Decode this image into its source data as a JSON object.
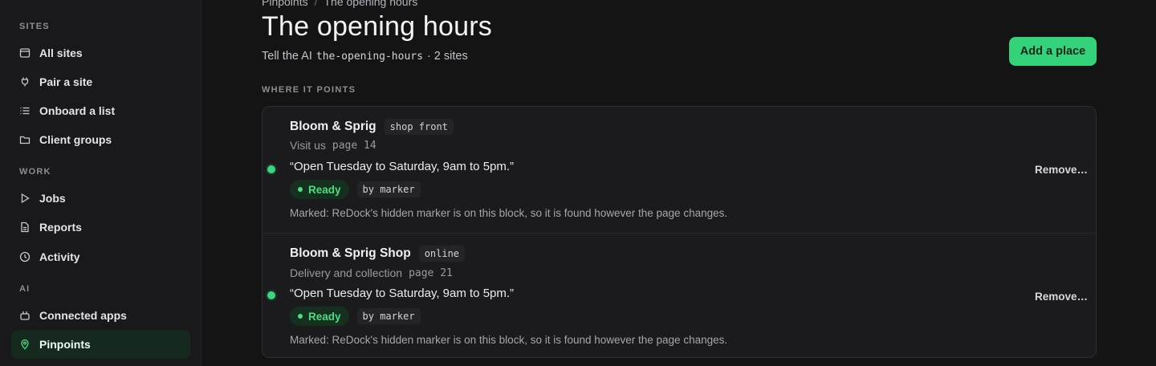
{
  "sidebar": {
    "sections": [
      {
        "label": "SITES"
      },
      {
        "label": "WORK"
      },
      {
        "label": "AI"
      }
    ],
    "items": [
      {
        "label": "All sites",
        "icon": "browser-window-icon"
      },
      {
        "label": "Pair a site",
        "icon": "plug-icon"
      },
      {
        "label": "Onboard a list",
        "icon": "list-icon"
      },
      {
        "label": "Client groups",
        "icon": "folder-icon"
      },
      {
        "label": "Jobs",
        "icon": "play-icon"
      },
      {
        "label": "Reports",
        "icon": "document-icon"
      },
      {
        "label": "Activity",
        "icon": "clock-icon"
      },
      {
        "label": "Connected apps",
        "icon": "plug-socket-icon"
      },
      {
        "label": "Pinpoints",
        "icon": "map-pin-icon",
        "active": true
      }
    ]
  },
  "header": {
    "breadcrumb": [
      "Pinpoints",
      "/",
      "The opening hours"
    ],
    "title": "The opening hours",
    "subtitle_prefix": "Tell the AI",
    "subtitle_code": "the-opening-hours",
    "subtitle_suffix": "· 2 sites",
    "add_button": "Add a place"
  },
  "main": {
    "section_label": "WHERE IT POINTS",
    "rows": [
      {
        "name": "Bloom & Sprig",
        "tag": "shop front",
        "page_label": "Visit us",
        "page_ref": "page 14",
        "quote": "“Open Tuesday to Saturday, 9am to 5pm.”",
        "status": "Ready",
        "method": "by marker",
        "note": "Marked: ReDock's hidden marker is on this block, so it is found however the page changes.",
        "remove": "Remove…"
      },
      {
        "name": "Bloom & Sprig Shop",
        "tag": "online",
        "page_label": "Delivery and collection",
        "page_ref": "page 21",
        "quote": "“Open Tuesday to Saturday, 9am to 5pm.”",
        "status": "Ready",
        "method": "by marker",
        "note": "Marked: ReDock's hidden marker is on this block, so it is found however the page changes.",
        "remove": "Remove…"
      }
    ]
  },
  "colors": {
    "accent": "#34d27a",
    "status_ready": "#4ade80",
    "background": "#141415",
    "sidebar": "#19191b"
  }
}
